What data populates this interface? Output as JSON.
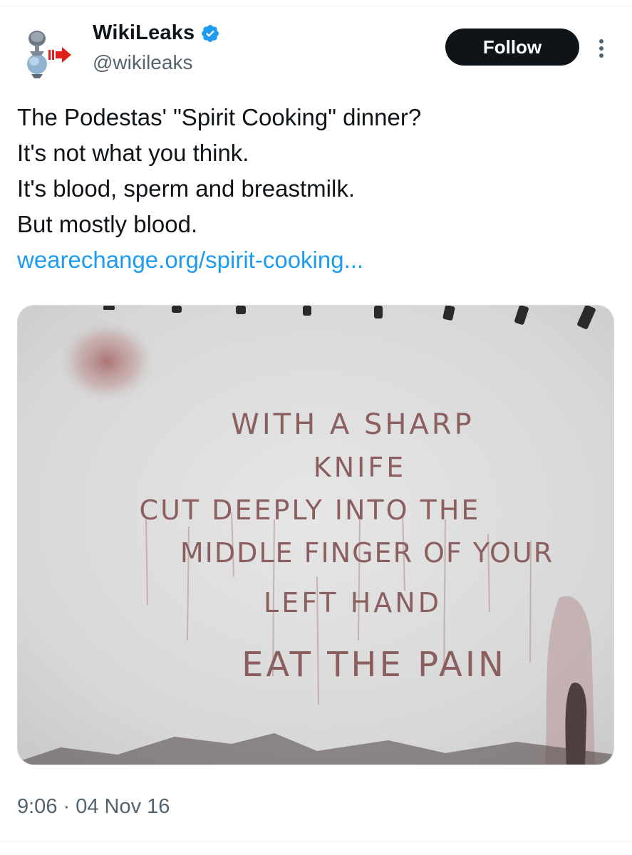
{
  "author": {
    "display_name": "WikiLeaks",
    "handle": "@wikileaks",
    "verified": true,
    "avatar_icon": "wikileaks-hourglass-logo-icon",
    "verified_icon": "verified-badge-icon",
    "verified_color": "#1d9bf0"
  },
  "actions": {
    "follow_label": "Follow",
    "more_icon": "more-vertical-icon"
  },
  "tweet": {
    "lines": [
      "The Podestas' \"Spirit Cooking\" dinner?",
      "It's not what you think.",
      "It's blood, sperm and breastmilk.",
      "But mostly blood."
    ],
    "link_text": "wearechange.org/spirit-cooking...",
    "link_color": "#1d9bf0"
  },
  "media": {
    "wall_text": [
      "WITH A SHARP",
      "KNIFE",
      "CUT DEEPLY INTO THE",
      "MIDDLE FINGER OF YOUR",
      "LEFT HAND",
      "EAT THE PAIN"
    ]
  },
  "meta": {
    "timestamp": "9:06 · 04 Nov 16"
  }
}
